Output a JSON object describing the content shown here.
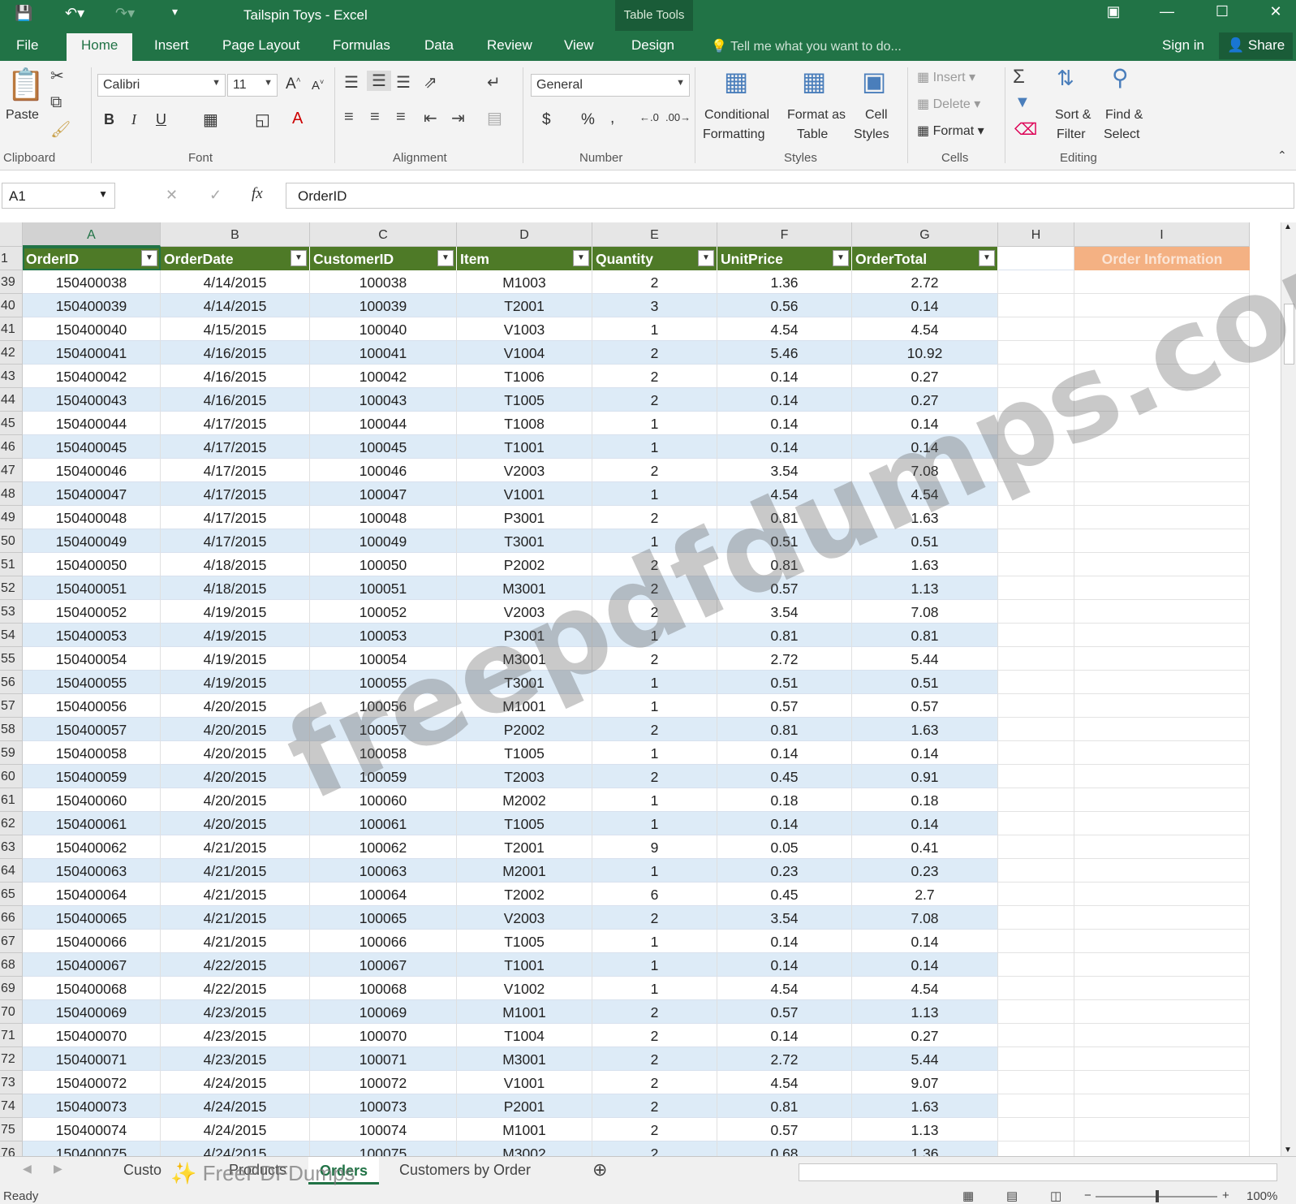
{
  "titlebar": {
    "title": "Tailspin Toys - Excel",
    "context": "Table Tools"
  },
  "tabs": [
    "File",
    "Home",
    "Insert",
    "Page Layout",
    "Formulas",
    "Data",
    "Review",
    "View",
    "Design"
  ],
  "tellme": "Tell me what you want to do...",
  "signin": "Sign in",
  "share": "Share",
  "ribbon": {
    "clipboard": {
      "paste": "Paste",
      "label": "Clipboard"
    },
    "font": {
      "name": "Calibri",
      "size": "11",
      "label": "Font"
    },
    "alignment": {
      "label": "Alignment"
    },
    "number": {
      "format": "General",
      "label": "Number"
    },
    "styles": {
      "cond1": "Conditional",
      "cond2": "Formatting",
      "fmt1": "Format as",
      "fmt2": "Table",
      "cell1": "Cell",
      "cell2": "Styles",
      "label": "Styles"
    },
    "cells": {
      "insert": "Insert",
      "delete": "Delete",
      "format": "Format",
      "label": "Cells"
    },
    "editing": {
      "sort1": "Sort &",
      "sort2": "Filter",
      "find1": "Find &",
      "find2": "Select",
      "label": "Editing"
    }
  },
  "formula": {
    "namebox": "A1",
    "fx": "fx",
    "content": "OrderID"
  },
  "columns": [
    "A",
    "B",
    "C",
    "D",
    "E",
    "F",
    "G",
    "H",
    "I"
  ],
  "headers": [
    "OrderID",
    "OrderDate",
    "CustomerID",
    "Item",
    "Quantity",
    "UnitPrice",
    "OrderTotal"
  ],
  "order_info": "Order Information",
  "rows": [
    [
      "39",
      "150400038",
      "4/14/2015",
      "100038",
      "M1003",
      "2",
      "1.36",
      "2.72"
    ],
    [
      "40",
      "150400039",
      "4/14/2015",
      "100039",
      "T2001",
      "3",
      "0.56",
      "0.14"
    ],
    [
      "41",
      "150400040",
      "4/15/2015",
      "100040",
      "V1003",
      "1",
      "4.54",
      "4.54"
    ],
    [
      "42",
      "150400041",
      "4/16/2015",
      "100041",
      "V1004",
      "2",
      "5.46",
      "10.92"
    ],
    [
      "43",
      "150400042",
      "4/16/2015",
      "100042",
      "T1006",
      "2",
      "0.14",
      "0.27"
    ],
    [
      "44",
      "150400043",
      "4/16/2015",
      "100043",
      "T1005",
      "2",
      "0.14",
      "0.27"
    ],
    [
      "45",
      "150400044",
      "4/17/2015",
      "100044",
      "T1008",
      "1",
      "0.14",
      "0.14"
    ],
    [
      "46",
      "150400045",
      "4/17/2015",
      "100045",
      "T1001",
      "1",
      "0.14",
      "0.14"
    ],
    [
      "47",
      "150400046",
      "4/17/2015",
      "100046",
      "V2003",
      "2",
      "3.54",
      "7.08"
    ],
    [
      "48",
      "150400047",
      "4/17/2015",
      "100047",
      "V1001",
      "1",
      "4.54",
      "4.54"
    ],
    [
      "49",
      "150400048",
      "4/17/2015",
      "100048",
      "P3001",
      "2",
      "0.81",
      "1.63"
    ],
    [
      "50",
      "150400049",
      "4/17/2015",
      "100049",
      "T3001",
      "1",
      "0.51",
      "0.51"
    ],
    [
      "51",
      "150400050",
      "4/18/2015",
      "100050",
      "P2002",
      "2",
      "0.81",
      "1.63"
    ],
    [
      "52",
      "150400051",
      "4/18/2015",
      "100051",
      "M3001",
      "2",
      "0.57",
      "1.13"
    ],
    [
      "53",
      "150400052",
      "4/19/2015",
      "100052",
      "V2003",
      "2",
      "3.54",
      "7.08"
    ],
    [
      "54",
      "150400053",
      "4/19/2015",
      "100053",
      "P3001",
      "1",
      "0.81",
      "0.81"
    ],
    [
      "55",
      "150400054",
      "4/19/2015",
      "100054",
      "M3001",
      "2",
      "2.72",
      "5.44"
    ],
    [
      "56",
      "150400055",
      "4/19/2015",
      "100055",
      "T3001",
      "1",
      "0.51",
      "0.51"
    ],
    [
      "57",
      "150400056",
      "4/20/2015",
      "100056",
      "M1001",
      "1",
      "0.57",
      "0.57"
    ],
    [
      "58",
      "150400057",
      "4/20/2015",
      "100057",
      "P2002",
      "2",
      "0.81",
      "1.63"
    ],
    [
      "59",
      "150400058",
      "4/20/2015",
      "100058",
      "T1005",
      "1",
      "0.14",
      "0.14"
    ],
    [
      "60",
      "150400059",
      "4/20/2015",
      "100059",
      "T2003",
      "2",
      "0.45",
      "0.91"
    ],
    [
      "61",
      "150400060",
      "4/20/2015",
      "100060",
      "M2002",
      "1",
      "0.18",
      "0.18"
    ],
    [
      "62",
      "150400061",
      "4/20/2015",
      "100061",
      "T1005",
      "1",
      "0.14",
      "0.14"
    ],
    [
      "63",
      "150400062",
      "4/21/2015",
      "100062",
      "T2001",
      "9",
      "0.05",
      "0.41"
    ],
    [
      "64",
      "150400063",
      "4/21/2015",
      "100063",
      "M2001",
      "1",
      "0.23",
      "0.23"
    ],
    [
      "65",
      "150400064",
      "4/21/2015",
      "100064",
      "T2002",
      "6",
      "0.45",
      "2.7"
    ],
    [
      "66",
      "150400065",
      "4/21/2015",
      "100065",
      "V2003",
      "2",
      "3.54",
      "7.08"
    ],
    [
      "67",
      "150400066",
      "4/21/2015",
      "100066",
      "T1005",
      "1",
      "0.14",
      "0.14"
    ],
    [
      "68",
      "150400067",
      "4/22/2015",
      "100067",
      "T1001",
      "1",
      "0.14",
      "0.14"
    ],
    [
      "69",
      "150400068",
      "4/22/2015",
      "100068",
      "V1002",
      "1",
      "4.54",
      "4.54"
    ],
    [
      "70",
      "150400069",
      "4/23/2015",
      "100069",
      "M1001",
      "2",
      "0.57",
      "1.13"
    ],
    [
      "71",
      "150400070",
      "4/23/2015",
      "100070",
      "T1004",
      "2",
      "0.14",
      "0.27"
    ],
    [
      "72",
      "150400071",
      "4/23/2015",
      "100071",
      "M3001",
      "2",
      "2.72",
      "5.44"
    ],
    [
      "73",
      "150400072",
      "4/24/2015",
      "100072",
      "V1001",
      "2",
      "4.54",
      "9.07"
    ],
    [
      "74",
      "150400073",
      "4/24/2015",
      "100073",
      "P2001",
      "2",
      "0.81",
      "1.63"
    ],
    [
      "75",
      "150400074",
      "4/24/2015",
      "100074",
      "M1001",
      "2",
      "0.57",
      "1.13"
    ],
    [
      "76",
      "150400075",
      "4/24/2015",
      "100075",
      "M3002",
      "2",
      "0.68",
      "1.36"
    ]
  ],
  "sheets": [
    "Custo",
    "Products",
    "Orders",
    "Customers by Order"
  ],
  "status": {
    "ready": "Ready",
    "zoom": "100%"
  },
  "watermark": "freepdfdumps.com",
  "watermark2": "FreePDFDumps",
  "colors": {
    "excel_green": "#217346",
    "table_header": "#4e7a27",
    "band": "#ddebf7",
    "order_info_bg": "#f4b183"
  }
}
